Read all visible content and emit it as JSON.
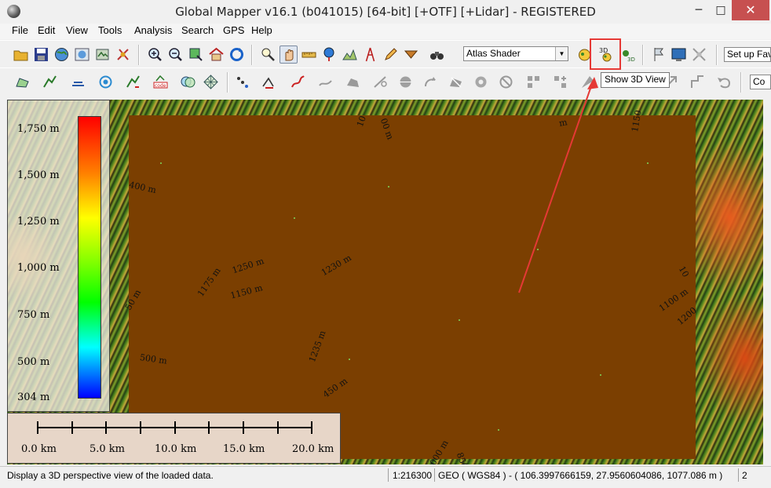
{
  "window": {
    "title": "Global Mapper v16.1 (b041015) [64-bit] [+OTF] [+Lidar] - REGISTERED",
    "minimize": "─",
    "maximize": "□",
    "close": "✕"
  },
  "menu": [
    "File",
    "Edit",
    "View",
    "Tools",
    "Analysis",
    "Search",
    "GPS",
    "Help"
  ],
  "toolbar": {
    "shader": "Atlas Shader",
    "favorites": "Set up Fav",
    "combo": "Co",
    "highlight_color": "#e53935"
  },
  "tooltip": "Show 3D View",
  "legend": {
    "labels": [
      "1,750 m",
      "1,500 m",
      "1,250 m",
      "1,000 m",
      "750 m",
      "500 m",
      "304 m"
    ]
  },
  "scalebar": {
    "labels": [
      "0.0 km",
      "5.0 km",
      "10.0 km",
      "15.0 km",
      "20.0 km"
    ]
  },
  "contours": [
    "400 m",
    "1250 m",
    "1230 m",
    "1175 m",
    "1150 m",
    "50 m",
    "500 m",
    "1235 m",
    "450 m",
    "000 m",
    "850",
    "10",
    "00 m",
    "m",
    "1150",
    "1100 m",
    "1200",
    "10"
  ],
  "status": {
    "message": "Display a 3D perspective view of the loaded data.",
    "scale": "1:216300",
    "coords": "GEO ( WGS84 ) - ( 106.3997666159, 27.9560604086, 1077.086 m )",
    "extra": "2"
  }
}
